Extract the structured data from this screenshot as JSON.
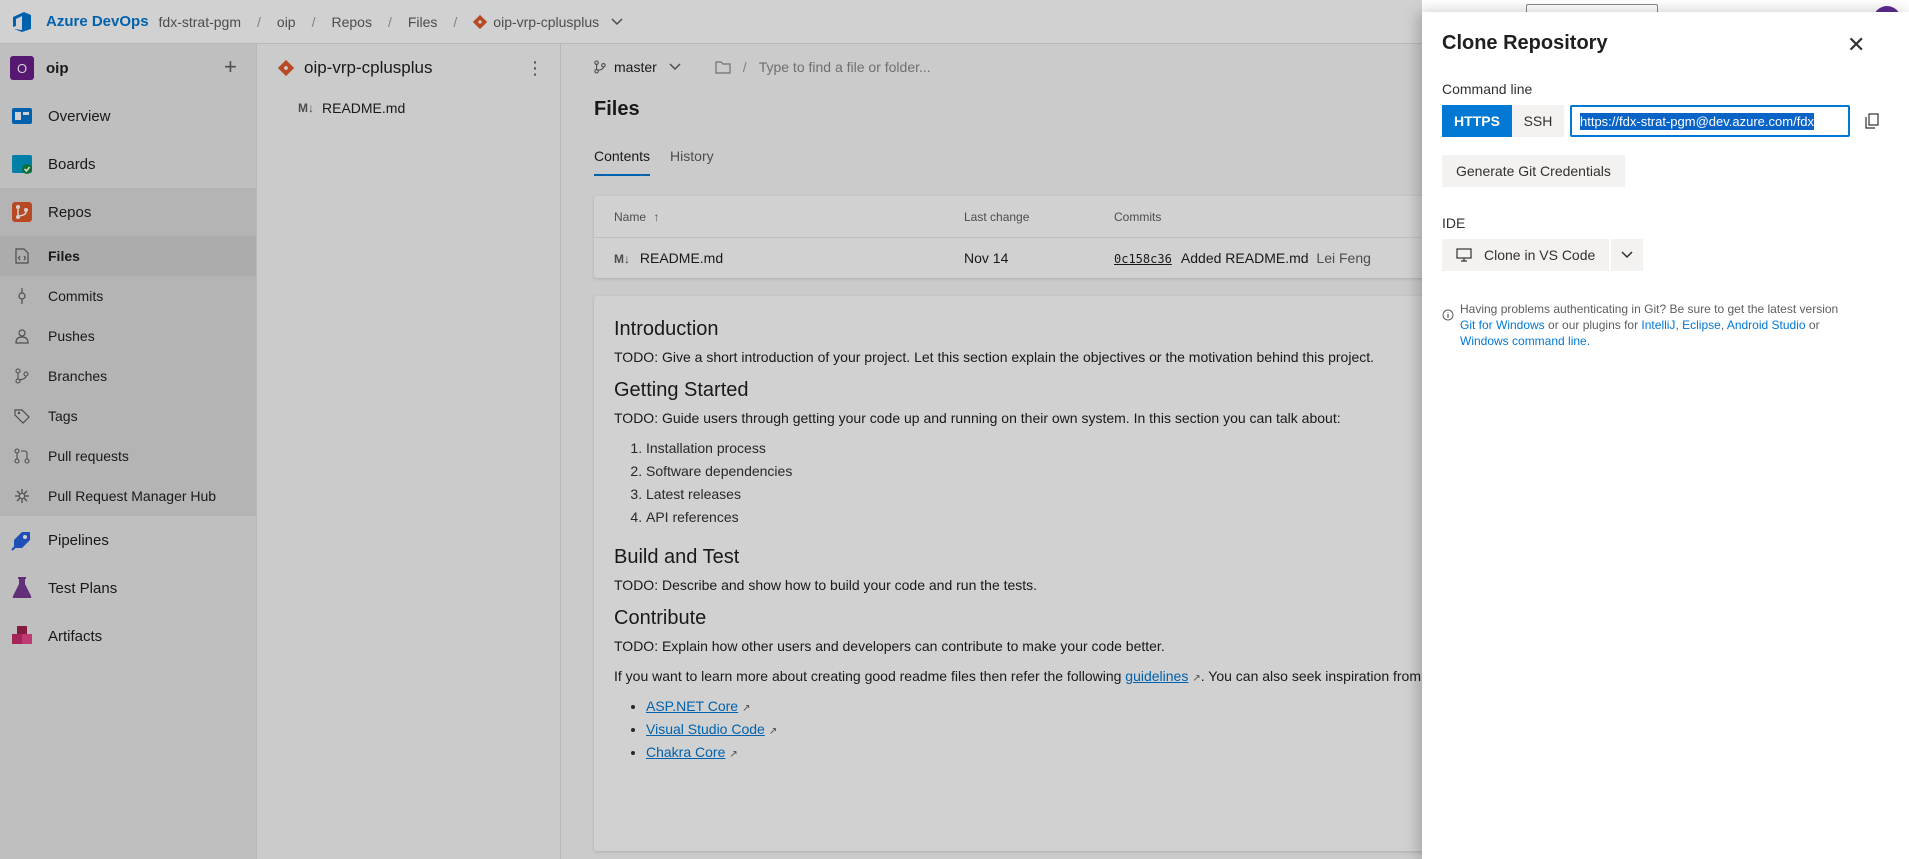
{
  "topbar": {
    "brand": "Azure DevOps",
    "org": "fdx-strat-pgm",
    "sep1": "/",
    "project": "oip",
    "sep2": "/",
    "section": "Repos",
    "sep3": "/",
    "page": "Files",
    "sep4": "/",
    "repo": "oip-vrp-cplusplus"
  },
  "nav": {
    "project_initial": "O",
    "project_name": "oip",
    "plus": "+",
    "items": [
      {
        "label": "Overview",
        "color": "#0078d4"
      },
      {
        "label": "Boards",
        "color": "#009ccc"
      },
      {
        "label": "Repos",
        "color": "#e05b2e"
      }
    ],
    "sub_items": [
      {
        "label": "Files",
        "icon": "files-icon"
      },
      {
        "label": "Commits",
        "icon": "commit-icon"
      },
      {
        "label": "Pushes",
        "icon": "push-icon"
      },
      {
        "label": "Branches",
        "icon": "branch-icon"
      },
      {
        "label": "Tags",
        "icon": "tag-icon"
      },
      {
        "label": "Pull requests",
        "icon": "pull-request-icon"
      },
      {
        "label": "Pull Request Manager Hub",
        "icon": "hub-icon"
      }
    ],
    "bottom_items": [
      {
        "label": "Pipelines",
        "color": "#2560e0"
      },
      {
        "label": "Test Plans",
        "color": "#773b93"
      },
      {
        "label": "Artifacts",
        "color": "#cb2e6d"
      }
    ]
  },
  "tree": {
    "repo": "oip-vrp-cplusplus",
    "kebab": "⋮",
    "md_glyph": "M↓",
    "file": "README.md"
  },
  "main": {
    "branch": "master",
    "path_slash": "/",
    "path_placeholder": "Type to find a file or folder...",
    "title": "Files",
    "tabs": [
      "Contents",
      "History"
    ],
    "table": {
      "headers": {
        "name": "Name",
        "sort_arrow": "↑",
        "last_change": "Last change",
        "commits": "Commits"
      },
      "row": {
        "md_glyph": "M↓",
        "name": "README.md",
        "last_change": "Nov 14",
        "hash": "0c158c36",
        "message": "Added README.md",
        "author": "Lei Feng"
      }
    },
    "readme": {
      "h_intro": "Introduction",
      "p_intro": "TODO: Give a short introduction of your project. Let this section explain the objectives or the motivation behind this project.",
      "h_start": "Getting Started",
      "p_start": "TODO: Guide users through getting your code up and running on their own system. In this section you can talk about:",
      "steps": [
        "Installation process",
        "Software dependencies",
        "Latest releases",
        "API references"
      ],
      "h_build": "Build and Test",
      "p_build": "TODO: Describe and show how to build your code and run the tests.",
      "h_contrib": "Contribute",
      "p_contrib": "TODO: Explain how other users and developers can contribute to make your code better.",
      "p_more_before": "If you want to learn more about creating good readme files then refer the following",
      "p_more_link": "guidelines",
      "p_more_after": ". You can also seek inspiration from",
      "links": [
        "ASP.NET Core",
        "Visual Studio Code",
        "Chakra Core"
      ]
    }
  },
  "panel": {
    "title": "Clone Repository",
    "close": "✕",
    "cmd_label": "Command line",
    "https": "HTTPS",
    "ssh": "SSH",
    "url": "https://fdx-strat-pgm@dev.azure.com/fdx",
    "gen_button": "Generate Git Credentials",
    "ide_label": "IDE",
    "clone_vs": "Clone in VS Code",
    "help_1": "Having problems authenticating in Git? Be sure to get the latest version",
    "help_git": "Git for Windows",
    "help_2": "or our plugins for",
    "help_intellij": "IntelliJ",
    "help_comma": ",",
    "help_eclipse": "Eclipse",
    "help_android": "Android Studio",
    "help_or": "or",
    "help_cmd": "Windows command line."
  },
  "colors": {
    "accent": "#0078d4",
    "project_badge": "#6b1e8a"
  }
}
